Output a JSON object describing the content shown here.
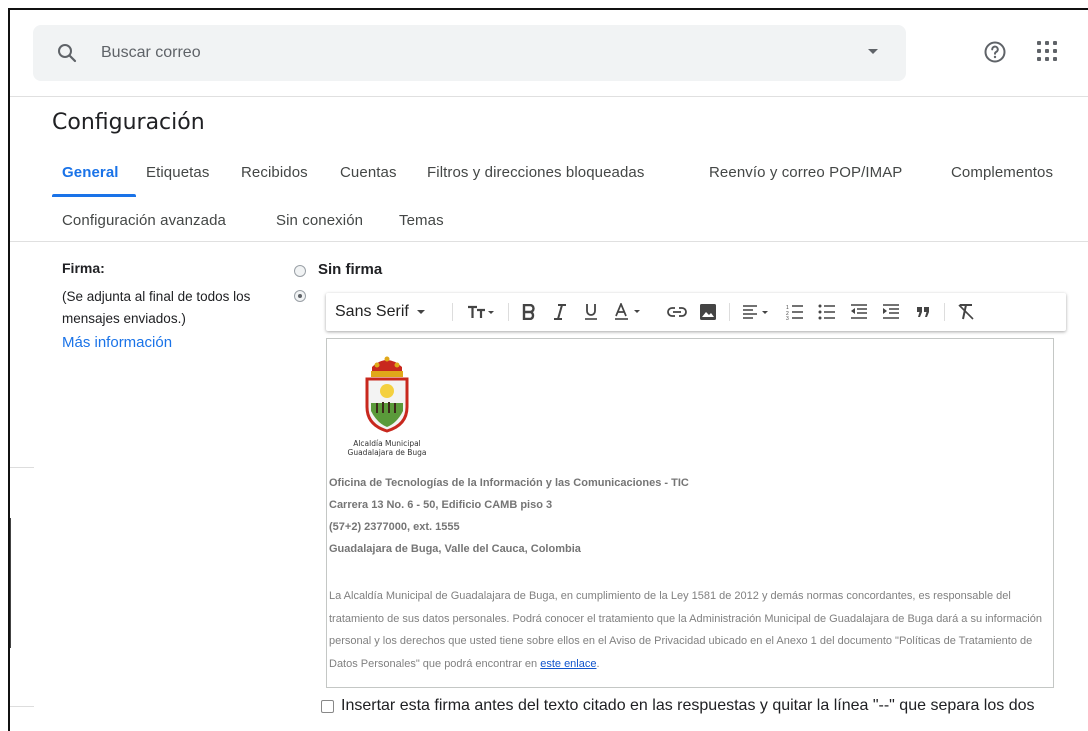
{
  "search": {
    "placeholder": "Buscar correo",
    "icon": "search-icon",
    "dropdown_icon": "chevron-down-icon"
  },
  "header_icons": {
    "help": "help-icon",
    "apps": "apps-grid-icon"
  },
  "page": {
    "title": "Configuración"
  },
  "tabs": [
    {
      "label": "General",
      "active": true
    },
    {
      "label": "Etiquetas"
    },
    {
      "label": "Recibidos"
    },
    {
      "label": "Cuentas"
    },
    {
      "label": "Filtros y direcciones bloqueadas"
    },
    {
      "label": "Reenvío y correo POP/IMAP"
    },
    {
      "label": "Complementos"
    },
    {
      "label": "Configuración avanzada"
    },
    {
      "label": "Sin conexión"
    },
    {
      "label": "Temas"
    }
  ],
  "signature": {
    "label": "Firma:",
    "description": "(Se adjunta al final de todos los mensajes enviados.)",
    "more_link": "Más información",
    "options": [
      {
        "label": "Sin firma",
        "checked": false
      },
      {
        "label": "",
        "checked": true
      }
    ],
    "toolbar": {
      "font": "Sans Serif",
      "buttons": [
        "text-size-icon",
        "bold-icon",
        "italic-icon",
        "underline-icon",
        "text-color-icon",
        "link-icon",
        "image-icon",
        "align-icon",
        "numbered-list-icon",
        "bulleted-list-icon",
        "indent-less-icon",
        "indent-more-icon",
        "quote-icon",
        "remove-formatting-icon"
      ]
    },
    "content": {
      "logo_caption_1": "Alcaldía Municipal",
      "logo_caption_2": "Guadalajara de Buga",
      "office": "Oficina de Tecnologías de la Información y las Comunicaciones - TIC",
      "address": "Carrera 13 No. 6 - 50, Edificio CAMB piso 3",
      "phone": "(57+2) 2377000, ext. 1555",
      "city": "Guadalajara de Buga, Valle del Cauca, Colombia",
      "legal_text": "La Alcaldía Municipal de Guadalajara de Buga, en cumplimiento de la Ley 1581 de 2012 y demás normas concordantes, es responsable del tratamiento de sus datos personales. Podrá conocer el tratamiento que la Administración Municipal de Guadalajara de Buga dará a su información personal y los derechos que usted tiene sobre ellos en el Aviso de Privacidad ubicado en el Anexo 1 del documento \"Políticas de Tratamiento de Datos Personales\" que podrá encontrar en",
      "legal_link": "este enlace",
      "legal_end": "."
    },
    "insert_before_quote_label": "Insertar esta firma antes del texto citado en las respuestas y quitar la línea \"--\" que separa los dos"
  },
  "colors": {
    "accent": "#1a73e8",
    "search_bg": "#f1f3f4",
    "link": "#1155cc"
  }
}
